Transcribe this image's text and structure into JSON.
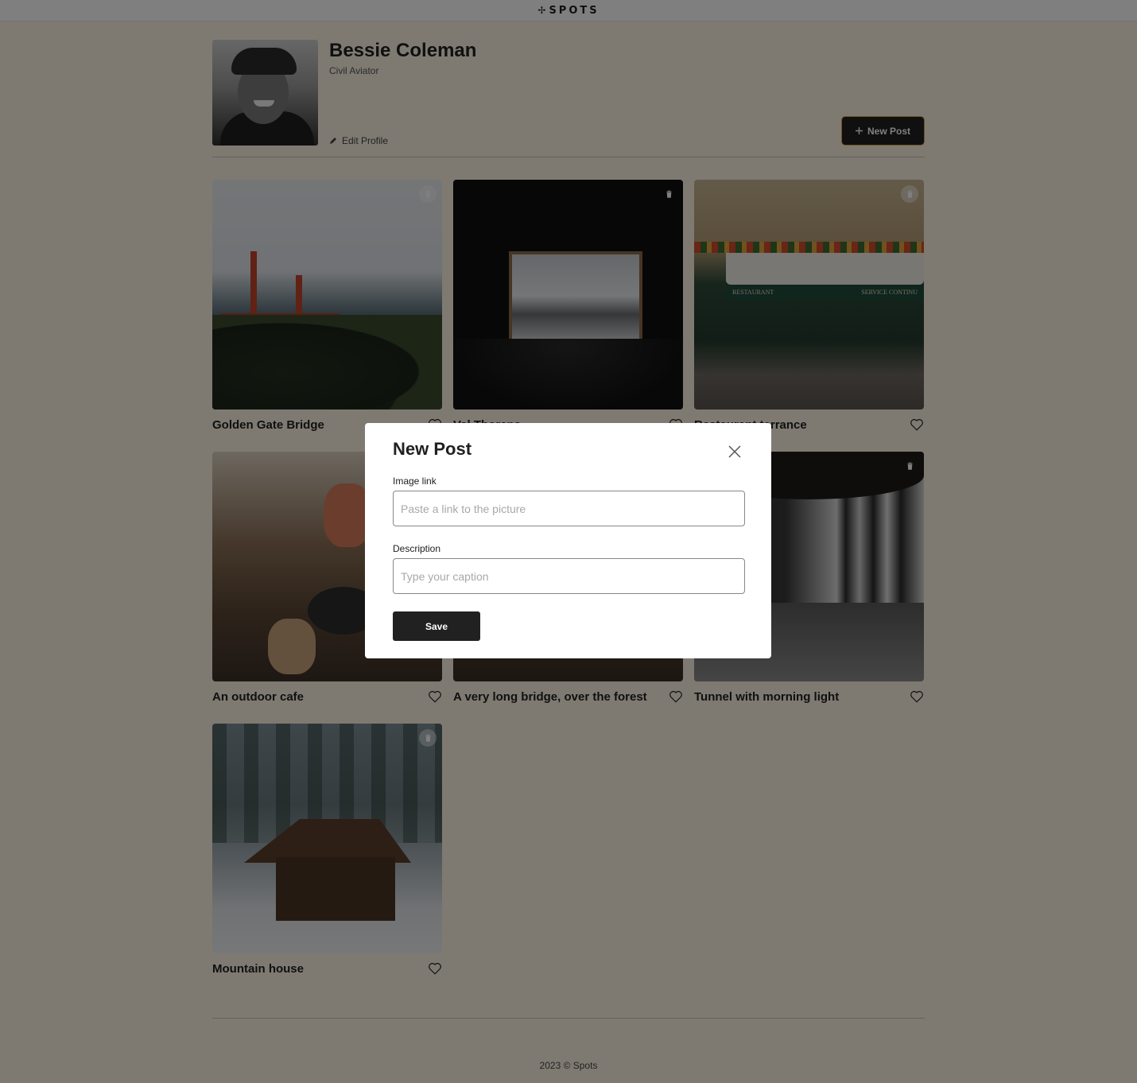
{
  "header": {
    "logo_text": "SPOTS",
    "logo_mark": "✢"
  },
  "profile": {
    "name": "Bessie Coleman",
    "description": "Civil Aviator",
    "edit_label": "Edit Profile",
    "new_post_label": "New Post"
  },
  "cards": [
    {
      "title": "Golden Gate Bridge"
    },
    {
      "title": "Val Thorens"
    },
    {
      "title": "Restaurant terrance"
    },
    {
      "title": "An outdoor cafe"
    },
    {
      "title": "A very long bridge, over the forest"
    },
    {
      "title": "Tunnel with morning light"
    },
    {
      "title": "Mountain house"
    }
  ],
  "modal": {
    "title": "New Post",
    "image_link_label": "Image link",
    "image_link_placeholder": "Paste a link to the picture",
    "description_label": "Description",
    "description_placeholder": "Type your caption",
    "save_label": "Save"
  },
  "footer": {
    "text": "2023 © Spots"
  },
  "colors": {
    "page_bg": "#fcf5e5",
    "button_dark": "#212121",
    "overlay": "rgba(0,0,0,0.5)"
  }
}
